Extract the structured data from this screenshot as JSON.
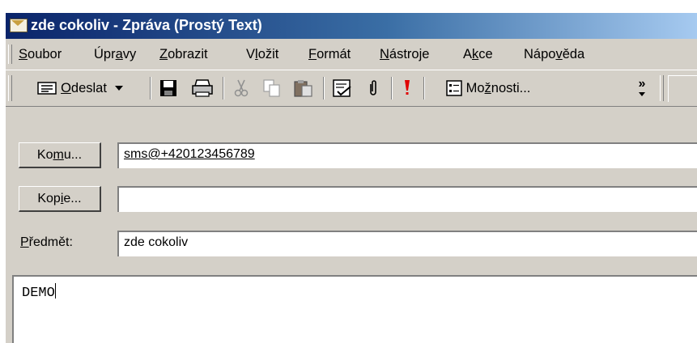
{
  "window": {
    "title": "zde cokoliv - Zpráva (Prostý Text)",
    "title_icon": "envelope-icon"
  },
  "menu": {
    "items": [
      {
        "label_pre": "",
        "label_key": "S",
        "label_post": "oubor"
      },
      {
        "label_pre": "Úpr",
        "label_key": "a",
        "label_post": "vy"
      },
      {
        "label_pre": "",
        "label_key": "Z",
        "label_post": "obrazit"
      },
      {
        "label_pre": "V",
        "label_key": "l",
        "label_post": "ožit"
      },
      {
        "label_pre": "",
        "label_key": "F",
        "label_post": "ormát"
      },
      {
        "label_pre": "",
        "label_key": "N",
        "label_post": "ástroje"
      },
      {
        "label_pre": "A",
        "label_key": "k",
        "label_post": "ce"
      },
      {
        "label_pre": "Nápo",
        "label_key": "v",
        "label_post": "ěda"
      }
    ]
  },
  "toolbar": {
    "send": {
      "key": "O",
      "rest": "deslat",
      "icon": "send-icon"
    },
    "options": {
      "pre": "Mo",
      "key": "ž",
      "rest": "nosti...",
      "icon": "options-icon"
    },
    "icons": [
      "save-icon",
      "print-icon",
      "cut-icon",
      "copy-icon",
      "paste-icon",
      "check-names-icon",
      "attach-icon",
      "importance-icon"
    ],
    "overflow": "»"
  },
  "fields": {
    "to": {
      "button_pre": "Ko",
      "button_key": "m",
      "button_post": "u...",
      "value": "sms@+420123456789"
    },
    "cc": {
      "button_pre": "Kop",
      "button_key": "i",
      "button_post": "e...",
      "value": ""
    },
    "subject": {
      "label_key": "P",
      "label_post": "ředmět:",
      "value": "zde cokoliv"
    }
  },
  "body": {
    "text": "DEMO"
  },
  "colors": {
    "titlebar_start": "#0a246a",
    "titlebar_end": "#a6caf0",
    "chrome": "#d4d0c8",
    "importance": "#e00000"
  }
}
